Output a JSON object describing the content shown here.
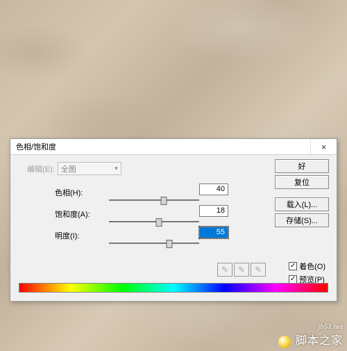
{
  "dialog": {
    "title": "色相/饱和度",
    "close": "×",
    "edit_label": "编辑(E):",
    "edit_value": "全图",
    "sliders": {
      "hue": {
        "label": "色相(H):",
        "value": "40",
        "percent": 61
      },
      "saturation": {
        "label": "饱和度(A):",
        "value": "18",
        "percent": 55
      },
      "lightness": {
        "label": "明度(I):",
        "value": "55",
        "percent": 67
      }
    },
    "buttons": {
      "ok": "好",
      "reset": "复位",
      "load": "载入(L)...",
      "save": "存储(S)..."
    },
    "checks": {
      "colorize": "着色(O)",
      "preview": "预览(P)"
    }
  },
  "watermark": {
    "url": "jb51.net",
    "text": "脚本之家"
  }
}
